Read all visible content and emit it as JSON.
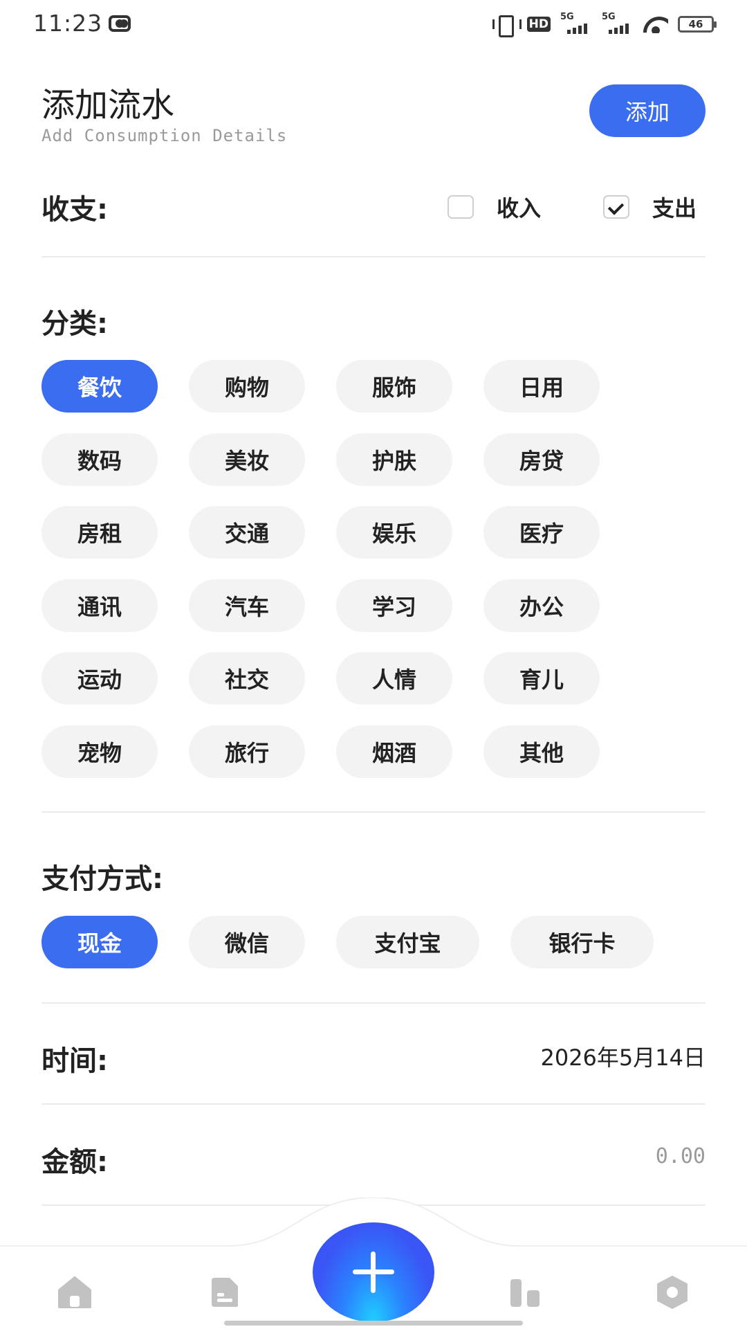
{
  "status_bar": {
    "time": "11:23",
    "hd_label": "HD",
    "net_1": "5G",
    "net_2": "5G",
    "battery": "46"
  },
  "header": {
    "title": "添加流水",
    "subtitle": "Add Consumption Details",
    "add_label": "添加"
  },
  "type_row": {
    "label": "收支:",
    "income_label": "收入",
    "income_checked": false,
    "expense_label": "支出",
    "expense_checked": true
  },
  "category": {
    "label": "分类:",
    "items": [
      "餐饮",
      "购物",
      "服饰",
      "日用",
      "数码",
      "美妆",
      "护肤",
      "房贷",
      "房租",
      "交通",
      "娱乐",
      "医疗",
      "通讯",
      "汽车",
      "学习",
      "办公",
      "运动",
      "社交",
      "人情",
      "育儿",
      "宠物",
      "旅行",
      "烟酒",
      "其他"
    ],
    "selected": "餐饮"
  },
  "payment": {
    "label": "支付方式:",
    "items": [
      "现金",
      "微信",
      "支付宝",
      "银行卡"
    ],
    "selected": "现金"
  },
  "time_row": {
    "label": "时间:",
    "value": "2026年5月14日"
  },
  "amount_row": {
    "label": "金额:",
    "placeholder": "0.00"
  },
  "nav": {
    "icons": [
      "home-icon",
      "bill-icon",
      "add-icon",
      "chart-icon",
      "settings-icon"
    ]
  },
  "colors": {
    "accent": "#3a6df0",
    "chip_bg": "#f3f3f3",
    "divider": "#ebebeb",
    "nav_icon": "#c2c2c2"
  }
}
